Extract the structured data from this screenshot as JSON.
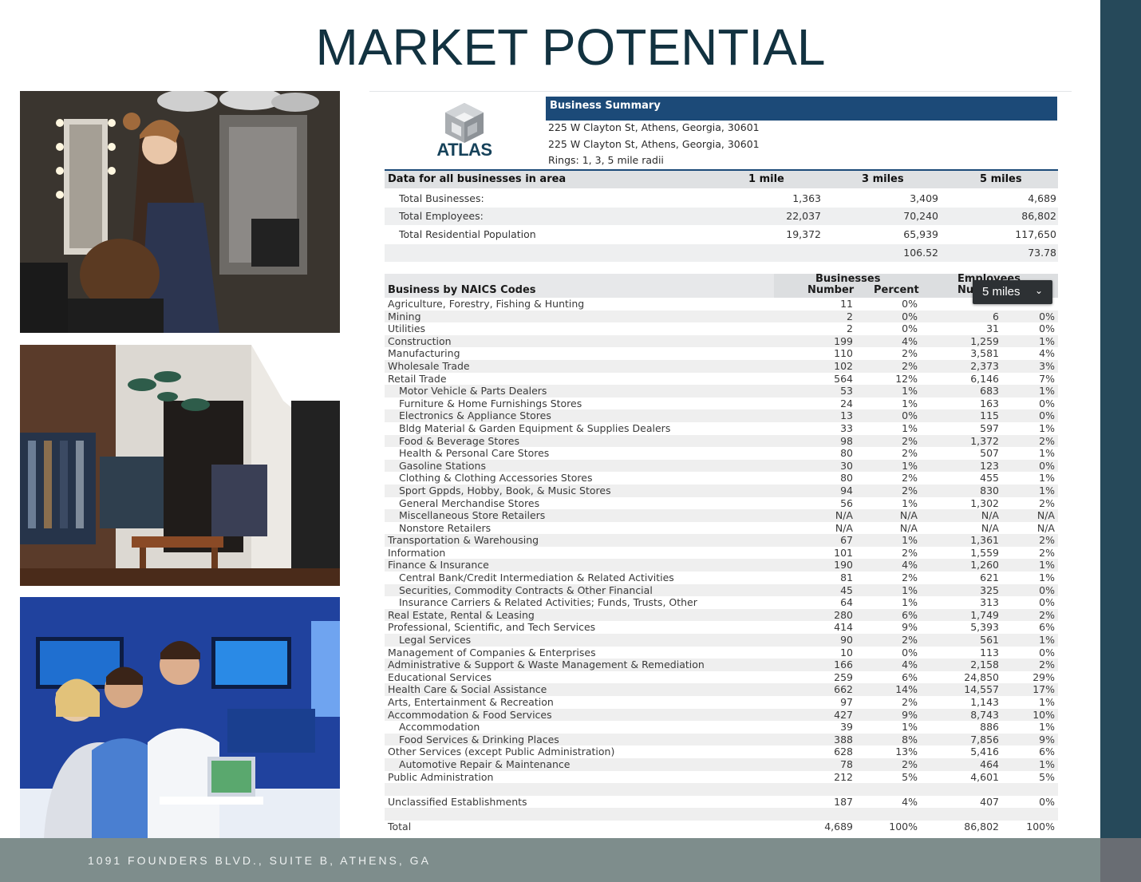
{
  "page": {
    "title": "MARKET POTENTIAL",
    "footer_address": "1091 FOUNDERS BLVD., SUITE B, ATHENS, GA"
  },
  "colors": {
    "title": "#123240",
    "band": "#26495a",
    "footer": "#7e8d8c",
    "summary_header": "#1c4a78"
  },
  "logo": {
    "name": "ATLAS",
    "icon": "atlas-cube-logo"
  },
  "report": {
    "header": "Business Summary",
    "address_1": "225 W Clayton St, Athens, Georgia, 30601",
    "address_2": "225 W Clayton St, Athens, Georgia, 30601",
    "rings": "Rings: 1, 3, 5 mile radii",
    "summary_title": "Data for all businesses in area",
    "radius_headers": [
      "1 mile",
      "3 miles",
      "5 miles"
    ],
    "summary_rows": [
      {
        "label": "Total Businesses:",
        "v1": "1,363",
        "v2": "3,409",
        "v3": "4,689"
      },
      {
        "label": "Total Employees:",
        "v1": "22,037",
        "v2": "70,240",
        "v3": "86,802"
      },
      {
        "label": "Total Residential Population",
        "v1": "19,372",
        "v2": "65,939",
        "v3": "117,650"
      },
      {
        "label": "",
        "v1": "",
        "v2": "106.52",
        "v3": "73.78"
      }
    ],
    "naics_title": "Business by NAICS Codes",
    "col_group_businesses": "Businesses",
    "col_group_employees": "Employees",
    "col_number": "Number",
    "col_percent": "Percent",
    "col_number_emp": "Nu",
    "dropdown_label": "5 miles",
    "rows": [
      {
        "label": "Agriculture, Forestry, Fishing & Hunting",
        "sub": false,
        "b": "11",
        "bp": "0%",
        "e": "",
        "ep": ""
      },
      {
        "label": "Mining",
        "sub": false,
        "b": "2",
        "bp": "0%",
        "e": "6",
        "ep": "0%"
      },
      {
        "label": "Utilities",
        "sub": false,
        "b": "2",
        "bp": "0%",
        "e": "31",
        "ep": "0%"
      },
      {
        "label": "Construction",
        "sub": false,
        "b": "199",
        "bp": "4%",
        "e": "1,259",
        "ep": "1%"
      },
      {
        "label": "Manufacturing",
        "sub": false,
        "b": "110",
        "bp": "2%",
        "e": "3,581",
        "ep": "4%"
      },
      {
        "label": "Wholesale Trade",
        "sub": false,
        "b": "102",
        "bp": "2%",
        "e": "2,373",
        "ep": "3%"
      },
      {
        "label": "Retail Trade",
        "sub": false,
        "b": "564",
        "bp": "12%",
        "e": "6,146",
        "ep": "7%"
      },
      {
        "label": "Motor Vehicle & Parts Dealers",
        "sub": true,
        "b": "53",
        "bp": "1%",
        "e": "683",
        "ep": "1%"
      },
      {
        "label": "Furniture & Home Furnishings Stores",
        "sub": true,
        "b": "24",
        "bp": "1%",
        "e": "163",
        "ep": "0%"
      },
      {
        "label": "Electronics & Appliance Stores",
        "sub": true,
        "b": "13",
        "bp": "0%",
        "e": "115",
        "ep": "0%"
      },
      {
        "label": "Bldg Material & Garden Equipment & Supplies Dealers",
        "sub": true,
        "b": "33",
        "bp": "1%",
        "e": "597",
        "ep": "1%"
      },
      {
        "label": "Food & Beverage Stores",
        "sub": true,
        "b": "98",
        "bp": "2%",
        "e": "1,372",
        "ep": "2%"
      },
      {
        "label": "Health & Personal Care Stores",
        "sub": true,
        "b": "80",
        "bp": "2%",
        "e": "507",
        "ep": "1%"
      },
      {
        "label": "Gasoline Stations",
        "sub": true,
        "b": "30",
        "bp": "1%",
        "e": "123",
        "ep": "0%"
      },
      {
        "label": "Clothing & Clothing Accessories Stores",
        "sub": true,
        "b": "80",
        "bp": "2%",
        "e": "455",
        "ep": "1%"
      },
      {
        "label": "Sport Gppds, Hobby, Book, & Music Stores",
        "sub": true,
        "b": "94",
        "bp": "2%",
        "e": "830",
        "ep": "1%"
      },
      {
        "label": "General Merchandise Stores",
        "sub": true,
        "b": "56",
        "bp": "1%",
        "e": "1,302",
        "ep": "2%"
      },
      {
        "label": "Miscellaneous Store Retailers",
        "sub": true,
        "b": "N/A",
        "bp": "N/A",
        "e": "N/A",
        "ep": "N/A"
      },
      {
        "label": "Nonstore Retailers",
        "sub": true,
        "b": "N/A",
        "bp": "N/A",
        "e": "N/A",
        "ep": "N/A"
      },
      {
        "label": "Transportation & Warehousing",
        "sub": false,
        "b": "67",
        "bp": "1%",
        "e": "1,361",
        "ep": "2%"
      },
      {
        "label": "Information",
        "sub": false,
        "b": "101",
        "bp": "2%",
        "e": "1,559",
        "ep": "2%"
      },
      {
        "label": "Finance & Insurance",
        "sub": false,
        "b": "190",
        "bp": "4%",
        "e": "1,260",
        "ep": "1%"
      },
      {
        "label": "Central Bank/Credit Intermediation & Related Activities",
        "sub": true,
        "b": "81",
        "bp": "2%",
        "e": "621",
        "ep": "1%"
      },
      {
        "label": "Securities, Commodity Contracts & Other Financial",
        "sub": true,
        "b": "45",
        "bp": "1%",
        "e": "325",
        "ep": "0%"
      },
      {
        "label": "Insurance Carriers & Related Activities; Funds, Trusts, Other",
        "sub": true,
        "b": "64",
        "bp": "1%",
        "e": "313",
        "ep": "0%"
      },
      {
        "label": "Real Estate, Rental & Leasing",
        "sub": false,
        "b": "280",
        "bp": "6%",
        "e": "1,749",
        "ep": "2%"
      },
      {
        "label": "Professional, Scientific, and Tech Services",
        "sub": false,
        "b": "414",
        "bp": "9%",
        "e": "5,393",
        "ep": "6%"
      },
      {
        "label": "Legal Services",
        "sub": true,
        "b": "90",
        "bp": "2%",
        "e": "561",
        "ep": "1%"
      },
      {
        "label": "Management of Companies & Enterprises",
        "sub": false,
        "b": "10",
        "bp": "0%",
        "e": "113",
        "ep": "0%"
      },
      {
        "label": "Administrative & Support & Waste Management & Remediation",
        "sub": false,
        "b": "166",
        "bp": "4%",
        "e": "2,158",
        "ep": "2%"
      },
      {
        "label": "Educational Services",
        "sub": false,
        "b": "259",
        "bp": "6%",
        "e": "24,850",
        "ep": "29%"
      },
      {
        "label": "Health Care & Social Assistance",
        "sub": false,
        "b": "662",
        "bp": "14%",
        "e": "14,557",
        "ep": "17%"
      },
      {
        "label": "Arts, Entertainment & Recreation",
        "sub": false,
        "b": "97",
        "bp": "2%",
        "e": "1,143",
        "ep": "1%"
      },
      {
        "label": "Accommodation & Food Services",
        "sub": false,
        "b": "427",
        "bp": "9%",
        "e": "8,743",
        "ep": "10%"
      },
      {
        "label": "Accommodation",
        "sub": true,
        "b": "39",
        "bp": "1%",
        "e": "886",
        "ep": "1%"
      },
      {
        "label": "Food Services & Drinking Places",
        "sub": true,
        "b": "388",
        "bp": "8%",
        "e": "7,856",
        "ep": "9%"
      },
      {
        "label": "Other Services (except Public Administration)",
        "sub": false,
        "b": "628",
        "bp": "13%",
        "e": "5,416",
        "ep": "6%"
      },
      {
        "label": "Automotive Repair & Maintenance",
        "sub": true,
        "b": "78",
        "bp": "2%",
        "e": "464",
        "ep": "1%"
      },
      {
        "label": "Public Administration",
        "sub": false,
        "b": "212",
        "bp": "5%",
        "e": "4,601",
        "ep": "5%"
      },
      {
        "label": "",
        "sub": false,
        "b": "",
        "bp": "",
        "e": "",
        "ep": ""
      },
      {
        "label": "Unclassified Establishments",
        "sub": false,
        "b": "187",
        "bp": "4%",
        "e": "407",
        "ep": "0%"
      },
      {
        "label": "",
        "sub": false,
        "b": "",
        "bp": "",
        "e": "",
        "ep": ""
      },
      {
        "label": "Total",
        "sub": false,
        "b": "4,689",
        "bp": "100%",
        "e": "86,802",
        "ep": "100%"
      }
    ]
  }
}
